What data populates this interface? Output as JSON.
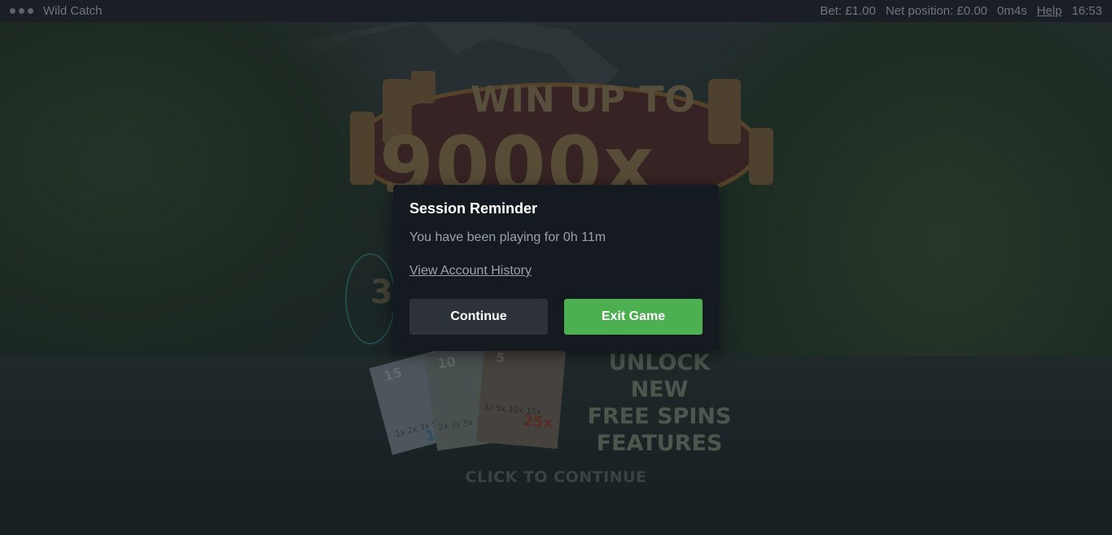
{
  "topbar": {
    "title": "Wild Catch",
    "bet": "Bet: £1.00",
    "net_position": "Net position: £0.00",
    "session_time": "0m4s",
    "help": "Help",
    "clock": "16:53"
  },
  "game": {
    "headline_top": "WIN UP TO",
    "headline_main": "9000x",
    "feature_line1": "UNLOCK NEW",
    "feature_line2": "FREE SPINS",
    "feature_line3": "FEATURES",
    "cta": "CLICK TO CONTINUE"
  },
  "modal": {
    "title": "Session Reminder",
    "message": "You have been playing for 0h 11m",
    "link": "View Account History",
    "continue_label": "Continue",
    "exit_label": "Exit Game"
  }
}
